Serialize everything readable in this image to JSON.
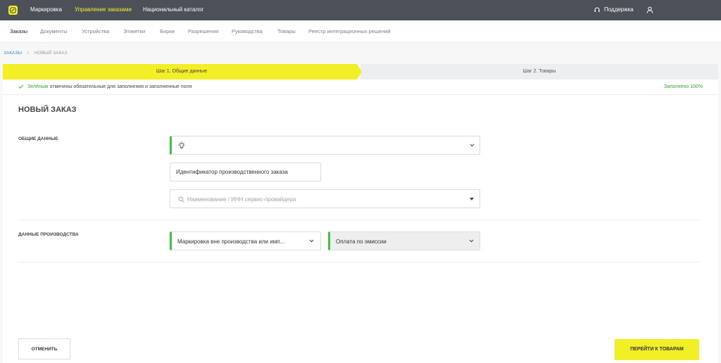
{
  "topbar": {
    "nav": [
      "Маркировка",
      "Управление заказами",
      "Национальный каталог"
    ],
    "support": "Поддержка"
  },
  "subnav": [
    "Заказы",
    "Документы",
    "Устройства",
    "Этикетки",
    "Бирки",
    "Разрешения",
    "Руководства",
    "Товары",
    "Реестр интеграционных решений"
  ],
  "breadcrumb": {
    "link": "ЗАКАЗЫ",
    "separator": "/",
    "current": "НОВЫЙ ЗАКАЗ"
  },
  "steps": {
    "step1": "Шаг 1. Общие данные",
    "step2": "Шаг 2. Товары"
  },
  "hint": {
    "green_word": "Зелёным",
    "text": " отмечены обязательные для заполнения и заполненные поля",
    "filled": "Заполнено 100%"
  },
  "form": {
    "title": "НОВЫЙ ЗАКАЗ",
    "general_label": "ОБЩИЕ ДАННЫЕ",
    "production_id": "Идентификатор производственного заказа",
    "provider_placeholder": "Наименование / ИНН сервис-провайдера",
    "production_label": "ДАННЫЕ ПРОИЗВОДСТВА",
    "marking_type": "Маркировка вне производства или имп...",
    "payment_type": "Оплата по эмиссии"
  },
  "buttons": {
    "cancel": "ОТМЕНИТЬ",
    "next": "ПЕРЕЙТИ К ТОВАРАМ"
  },
  "colors": {
    "accent": "#f2ef27",
    "topbar": "#4c5159",
    "valid": "#3ec43e",
    "link": "#3a84c8"
  }
}
